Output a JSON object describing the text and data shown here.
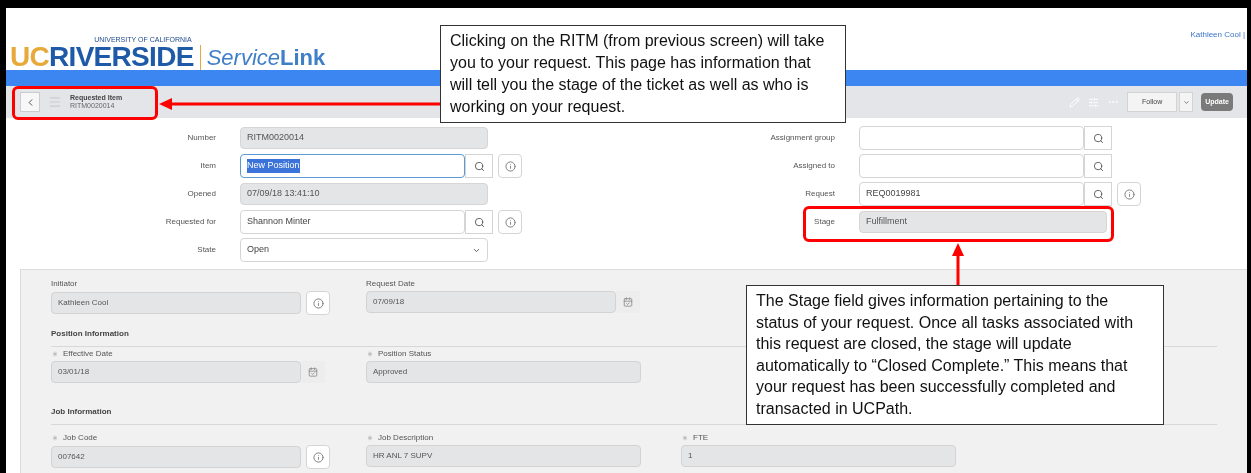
{
  "header": {
    "logo": {
      "tagline": "UNIVERSITY OF CALIFORNIA",
      "prefix": "UC",
      "name": "RIVERSIDE",
      "product_light": "Service",
      "product_bold": "Link"
    },
    "user": "Kathleen Cool |"
  },
  "toolbar": {
    "title": "Requested Item",
    "number": "RITM0020014",
    "follow": "Follow",
    "update": "Update"
  },
  "form": {
    "left": [
      {
        "label": "Number",
        "value": "RITM0020014",
        "kind": "readonly"
      },
      {
        "label": "Item",
        "value": "New Position",
        "kind": "lookup",
        "info": true,
        "focused": true,
        "text_selected": true
      },
      {
        "label": "Opened",
        "value": "07/09/18 13:41:10",
        "kind": "readonly"
      },
      {
        "label": "Requested for",
        "value": "Shannon Minter",
        "kind": "lookup",
        "info": true,
        "focused": false
      },
      {
        "label": "State",
        "value": "Open",
        "kind": "select"
      }
    ],
    "right": [
      {
        "label": "Assignment group",
        "kind": "lookup",
        "info": false,
        "focused": false
      },
      {
        "label": "Assigned to",
        "kind": "lookup",
        "info": false,
        "focused": false
      },
      {
        "label": "Request",
        "value": "REQ0019981",
        "kind": "lookup",
        "info": true,
        "focused": false
      },
      {
        "label": "Stage",
        "value": "Fulfillment",
        "kind": "readonly"
      }
    ]
  },
  "variables": [
    {
      "kind": "row",
      "fields": [
        {
          "label": "Initiator",
          "value": "Kathleen Cool",
          "mandatory": false,
          "kind": "info"
        },
        {
          "label": "Request Date",
          "value": "07/09/18",
          "mandatory": false,
          "kind": "calendar"
        }
      ]
    },
    {
      "kind": "heading",
      "text": "Position Information"
    },
    {
      "kind": "row",
      "fields": [
        {
          "label": "Effective Date",
          "value": "03/01/18",
          "mandatory": true,
          "kind": "calendar"
        },
        {
          "label": "Position Status",
          "value": "Approved",
          "mandatory": true,
          "kind": "plain"
        }
      ]
    },
    {
      "kind": "heading",
      "text": "Job Information"
    },
    {
      "kind": "row",
      "fields": [
        {
          "label": "Job Code",
          "value": "007642",
          "mandatory": true,
          "kind": "info"
        },
        {
          "label": "Job Description",
          "value": "HR ANL 7 SUPV",
          "mandatory": true,
          "kind": "plain"
        },
        {
          "label": "FTE",
          "value": "1",
          "mandatory": true,
          "kind": "plain"
        }
      ]
    }
  ],
  "callouts": [
    {
      "kind": "toolbar",
      "text": "Clicking on the RITM (from previous screen) will take you to your request. This page has information that will tell you the stage of the ticket as well as who is working on your request."
    },
    {
      "kind": "stage",
      "text": "The Stage field gives information pertaining to the status of your request. Once all tasks associated with this request are closed, the stage will update automatically to “Closed Complete.” This means that your request has been successfully completed and transacted in UCPath."
    }
  ]
}
